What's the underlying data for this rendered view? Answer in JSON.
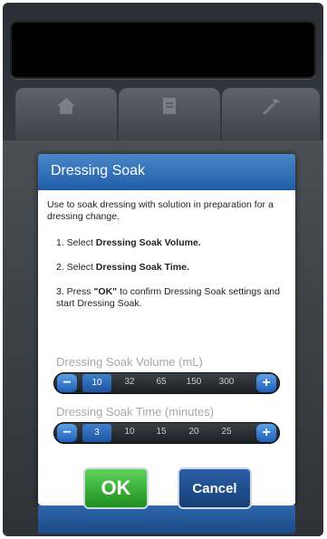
{
  "dialog": {
    "title": "Dressing Soak",
    "intro": "Use to soak dressing with solution in preparation for a dressing change.",
    "steps": [
      {
        "prefix": "1. Select ",
        "bold": "Dressing Soak Volume.",
        "suffix": ""
      },
      {
        "prefix": "2. Select ",
        "bold": "Dressing Soak Time.",
        "suffix": ""
      },
      {
        "prefix": "3. Press ",
        "bold": "\"OK\"",
        "suffix": " to confirm Dressing Soak settings and start Dressing Soak."
      }
    ]
  },
  "volume": {
    "label": "Dressing Soak Volume (mL)",
    "options": [
      "10",
      "32",
      "65",
      "150",
      "300"
    ],
    "selected": "10"
  },
  "time": {
    "label": "Dressing Soak Time (minutes)",
    "options": [
      "3",
      "10",
      "15",
      "20",
      "25"
    ],
    "selected": "3"
  },
  "buttons": {
    "ok": "OK",
    "cancel": "Cancel",
    "minus": "−",
    "plus": "+"
  },
  "tabs": [
    {
      "icon": "home-icon"
    },
    {
      "icon": "document-icon"
    },
    {
      "icon": "tools-icon"
    }
  ],
  "colors": {
    "accent": "#1f5fa8",
    "ok": "#1e8e1f"
  }
}
